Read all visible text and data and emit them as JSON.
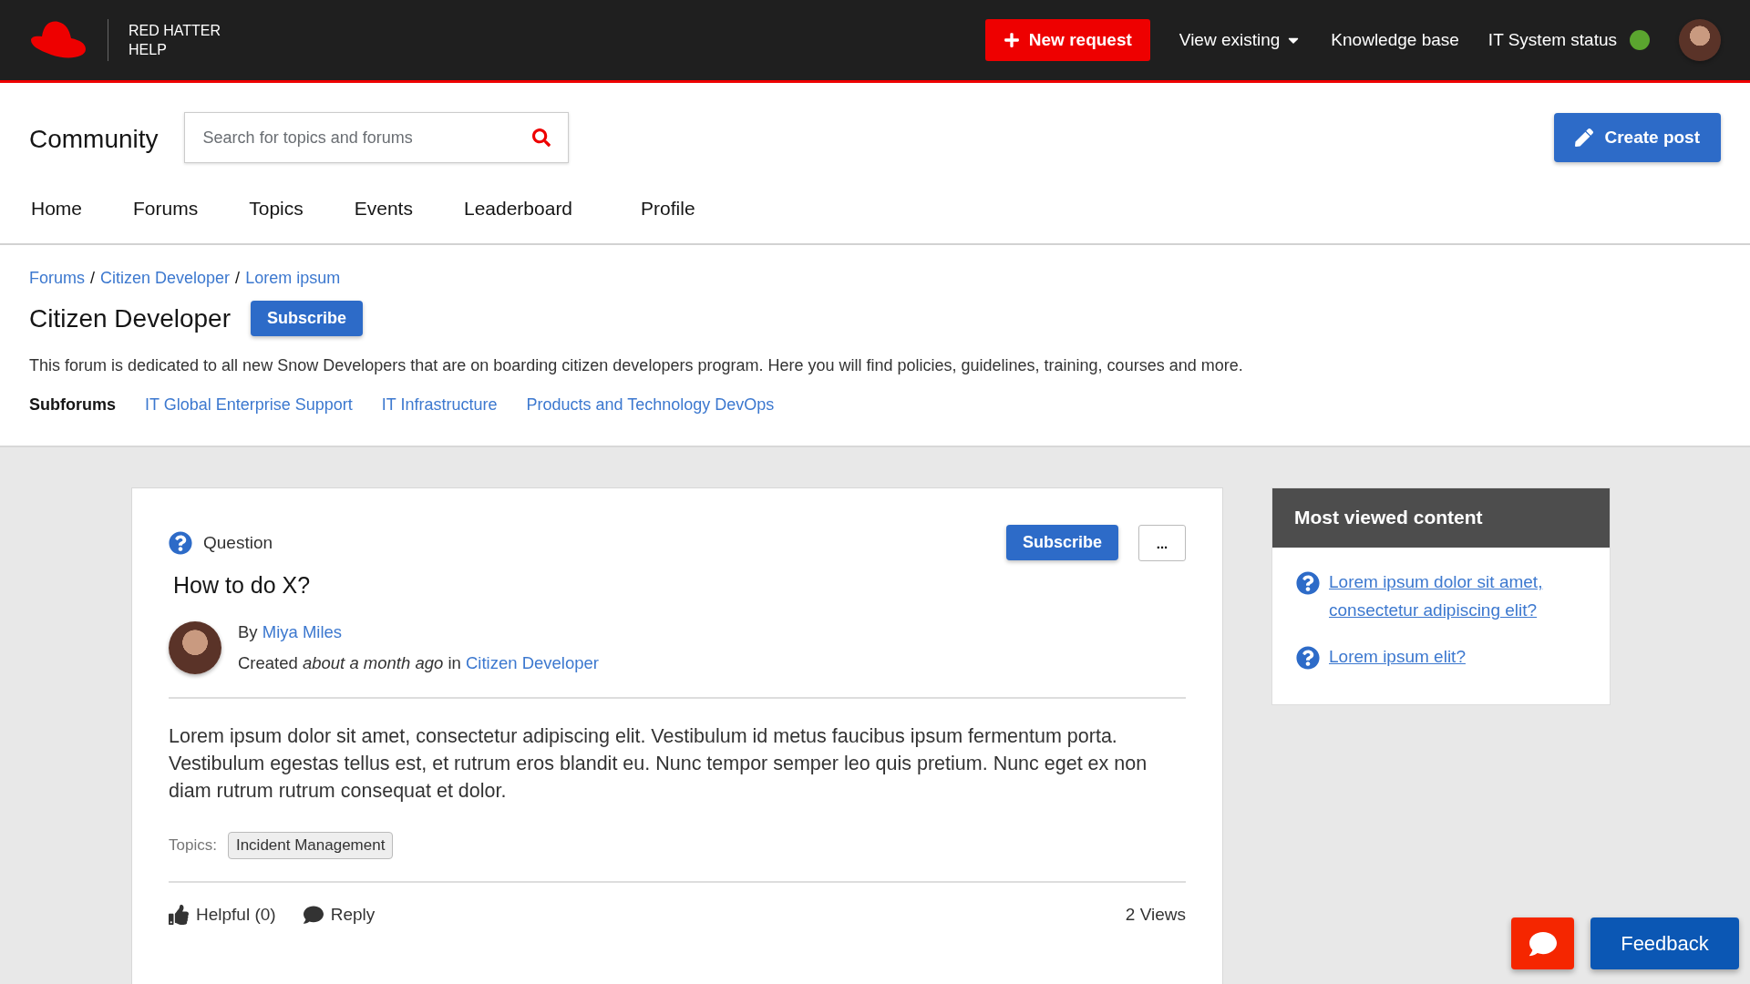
{
  "header": {
    "brand": [
      "RED HATTER",
      "HELP"
    ],
    "new_request": "New request",
    "view_existing": "View existing",
    "knowledge_base": "Knowledge base",
    "status_label": "IT System status"
  },
  "community": {
    "title": "Community",
    "search": {
      "placeholder": "Search for topics and forums"
    },
    "create_post": "Create post"
  },
  "nav": [
    "Home",
    "Forums",
    "Topics",
    "Events",
    "Leaderboard",
    "Profile"
  ],
  "breadcrumbs": {
    "separator": "/",
    "items": [
      "Forums",
      "Citizen Developer",
      "Lorem ipsum"
    ]
  },
  "forum": {
    "title": "Citizen Developer",
    "subscribe": "Subscribe",
    "description": "This forum is dedicated to all new Snow Developers that are on boarding citizen developers program. Here you will find policies, guidelines, training, courses and more.",
    "subforums_label": "Subforums",
    "subforums": [
      "IT Global Enterprise Support",
      "IT Infrastructure",
      "Products and Technology DevOps"
    ]
  },
  "post": {
    "type_label": "Question",
    "subscribe": "Subscribe",
    "more": "...",
    "title": "How to do X?",
    "by": "By",
    "author": "Miya Miles",
    "created": "Created *about a month ago* in",
    "forum": "Citizen Developer",
    "body": "Lorem ipsum dolor sit amet, consectetur adipiscing elit. Vestibulum id metus faucibus ipsum fermentum porta. Vestibulum egestas tellus est, et rutrum eros blandit eu. Nunc tempor semper leo quis pretium. Nunc eget ex non diam rutrum rutrum consequat et dolor.",
    "topics_label": "Topics:",
    "topics": [
      "Incident Management"
    ],
    "helpful": "Helpful (0)",
    "reply": "Reply",
    "views": "2 Views"
  },
  "most_viewed": {
    "title": "Most viewed content",
    "items": [
      "Lorem ipsum dolor sit amet, consectetur adipiscing elit?",
      "Lorem ipsum elit?"
    ]
  },
  "feedback": "Feedback"
}
